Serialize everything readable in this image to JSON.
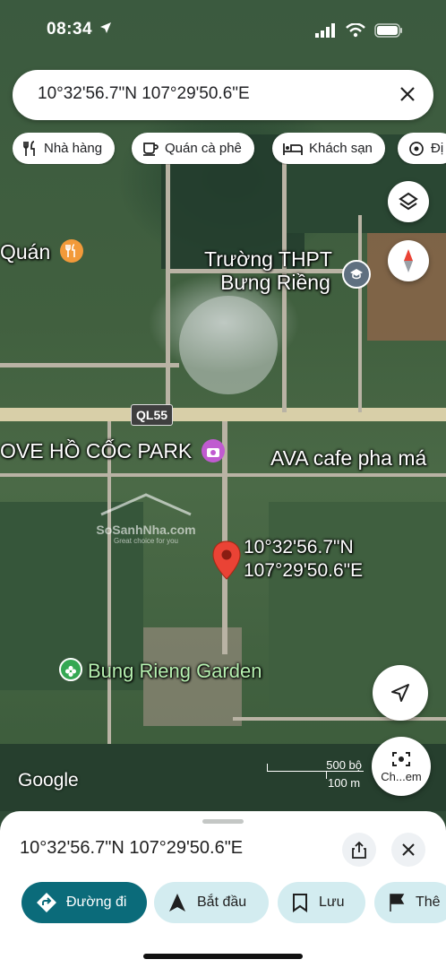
{
  "status_bar": {
    "time": "08:34"
  },
  "search": {
    "query": "10°32'56.7\"N 107°29'50.6\"E"
  },
  "chips": [
    {
      "label": "Nhà hàng",
      "icon": "fork-knife-icon"
    },
    {
      "label": "Quán cà phê",
      "icon": "coffee-cup-icon"
    },
    {
      "label": "Khách sạn",
      "icon": "bed-icon"
    },
    {
      "label": "Đị",
      "icon": "landmark-icon"
    }
  ],
  "map": {
    "labels": {
      "quan": "Quán",
      "school_line1": "Trường THPT",
      "school_line2": "Bưng Riềng",
      "road": "QL55",
      "park": "OVE HỒ CỐC PARK",
      "cafe": "AVA cafe pha má",
      "pin_line1": "10°32'56.7\"N",
      "pin_line2": "107°29'50.6\"E",
      "garden": "Bung Rieng Garden",
      "watermark": "SoSanhNha.com",
      "watermark_tag": "Great choice for you"
    },
    "google_logo": "Google",
    "scale": {
      "top": "500 bộ",
      "bottom": "100 m"
    },
    "camera_label": "Ch...em"
  },
  "sheet": {
    "title": "10°32'56.7\"N 107°29'50.6\"E",
    "actions": [
      {
        "label": "Đường đi",
        "icon": "directions-icon"
      },
      {
        "label": "Bắt đầu",
        "icon": "navigation-arrow-icon"
      },
      {
        "label": "Lưu",
        "icon": "bookmark-icon"
      },
      {
        "label": "Thê",
        "icon": "flag-icon"
      }
    ]
  },
  "colors": {
    "primary": "#0b57d0",
    "action_bg": "#d3e3fd",
    "pin": "#ea4335",
    "directions_btn": "#0b6b7a"
  }
}
